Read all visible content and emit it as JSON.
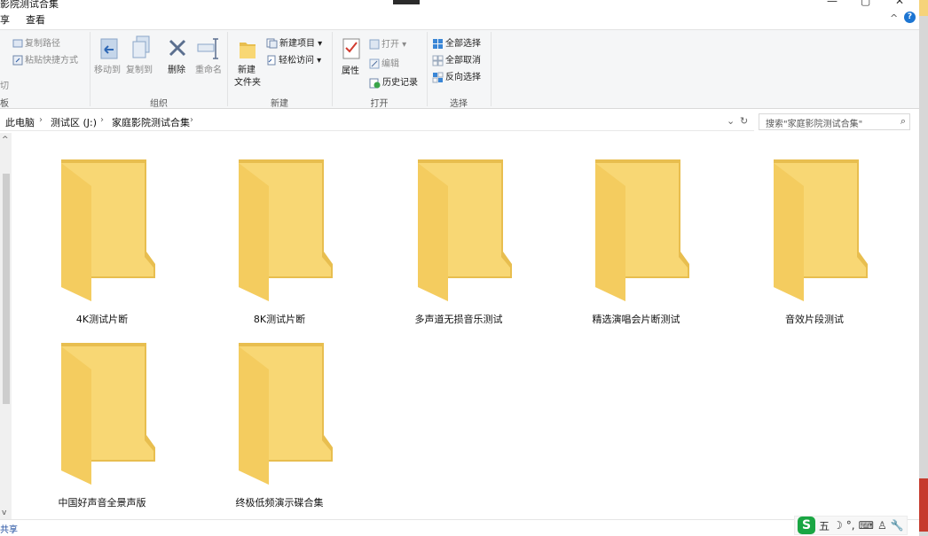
{
  "window": {
    "title": "影院测试合集",
    "minimize": "—",
    "restore": "▢",
    "close": "✕"
  },
  "tabs": {
    "share": "享",
    "view": "查看"
  },
  "ribbon": {
    "clipboard": {
      "copy_path": "复制路径",
      "paste_shortcut": "粘贴快捷方式",
      "cut": "切",
      "group": "板"
    },
    "organize": {
      "move_to": "移动到",
      "copy_to": "复制到",
      "delete": "删除",
      "rename": "重命名",
      "group": "组织"
    },
    "new": {
      "new_folder_line1": "新建",
      "new_folder_line2": "文件夹",
      "new_item": "新建项目",
      "easy_access": "轻松访问",
      "group": "新建"
    },
    "open": {
      "properties": "属性",
      "open": "打开",
      "edit": "编辑",
      "history": "历史记录",
      "group": "打开"
    },
    "select": {
      "select_all": "全部选择",
      "select_none": "全部取消",
      "invert": "反向选择",
      "group": "选择"
    }
  },
  "address": {
    "crumbs": [
      "此电脑",
      "测试区 (J:)",
      "家庭影院测试合集"
    ],
    "search_placeholder": "搜索\"家庭影院测试合集\""
  },
  "folders": [
    {
      "name": "4K测试片断"
    },
    {
      "name": "8K测试片断"
    },
    {
      "name": "多声道无损音乐测试"
    },
    {
      "name": "精选演唱会片断测试"
    },
    {
      "name": "音效片段测试"
    },
    {
      "name": "中国好声音全景声版"
    },
    {
      "name": "终极低频演示碟合集"
    }
  ],
  "status": {
    "left": "共享"
  },
  "ime": {
    "logo": "S",
    "mode": "五"
  },
  "colors": {
    "folder_back": "#e8be4f",
    "folder_front": "#f8d774",
    "accent": "#1c75d2"
  }
}
